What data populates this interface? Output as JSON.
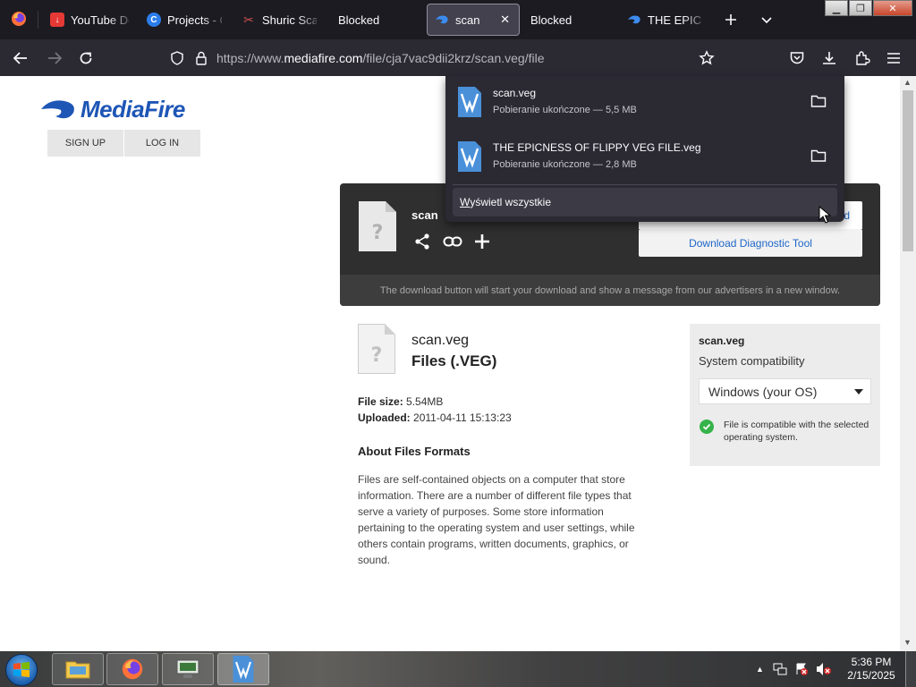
{
  "browser": {
    "tabs": [
      {
        "label": "YouTube Do",
        "icon": "youtube-downloader-icon",
        "color": "#e53935"
      },
      {
        "label": "Projects - C",
        "icon": "canva-icon",
        "color": "#2b7de9"
      },
      {
        "label": "Shuric Scan",
        "icon": "scan-icon",
        "color": "#c24a4a"
      },
      {
        "label": "Blocked",
        "icon": "",
        "color": ""
      },
      {
        "label": "scan",
        "icon": "mediafire-icon",
        "color": "#2f7ad1",
        "active": true
      },
      {
        "label": "Blocked",
        "icon": "",
        "color": ""
      },
      {
        "label": "THE EPICNE",
        "icon": "mediafire-icon",
        "color": "#2f7ad1"
      }
    ],
    "url": {
      "prefix": "https://www.",
      "host": "mediafire.com",
      "path": "/file/cja7vac9dii2krz/scan.veg/file"
    }
  },
  "site": {
    "logo_text": "MediaFire",
    "signup_label": "SIGN UP",
    "login_label": "LOG IN"
  },
  "download_box": {
    "file_name": "scan",
    "button_partial": "d",
    "diagnostic_label": "Download Diagnostic Tool",
    "note": "The download button will start your download and show a message from our advertisers in a new window."
  },
  "file_info": {
    "name": "scan.veg",
    "type": "Files (.VEG)",
    "size_label": "File size:",
    "size_value": "5.54MB",
    "uploaded_label": "Uploaded:",
    "uploaded_value": "2011-04-11 15:13:23",
    "about_heading": "About Files Formats",
    "about_text": "Files are self-contained objects on a computer that store information. There are a number of different file types that serve a variety of purposes. Some store information pertaining to the operating system and user settings, while others contain programs, written documents, graphics, or sound."
  },
  "compat": {
    "file_name": "scan.veg",
    "subtitle": "System compatibility",
    "selected_os": "Windows (your OS)",
    "message": "File is compatible with the selected operating system."
  },
  "downloads_panel": {
    "items": [
      {
        "name": "scan.veg",
        "status": "Pobieranie ukończone — 5,5 MB"
      },
      {
        "name": "THE EPICNESS OF FLIPPY VEG FILE.veg",
        "status": "Pobieranie ukończone — 2,8 MB"
      }
    ],
    "show_all_first": "W",
    "show_all_rest": "yświetl wszystkie"
  },
  "taskbar": {
    "time": "5:36 PM",
    "date": "2/15/2025"
  }
}
